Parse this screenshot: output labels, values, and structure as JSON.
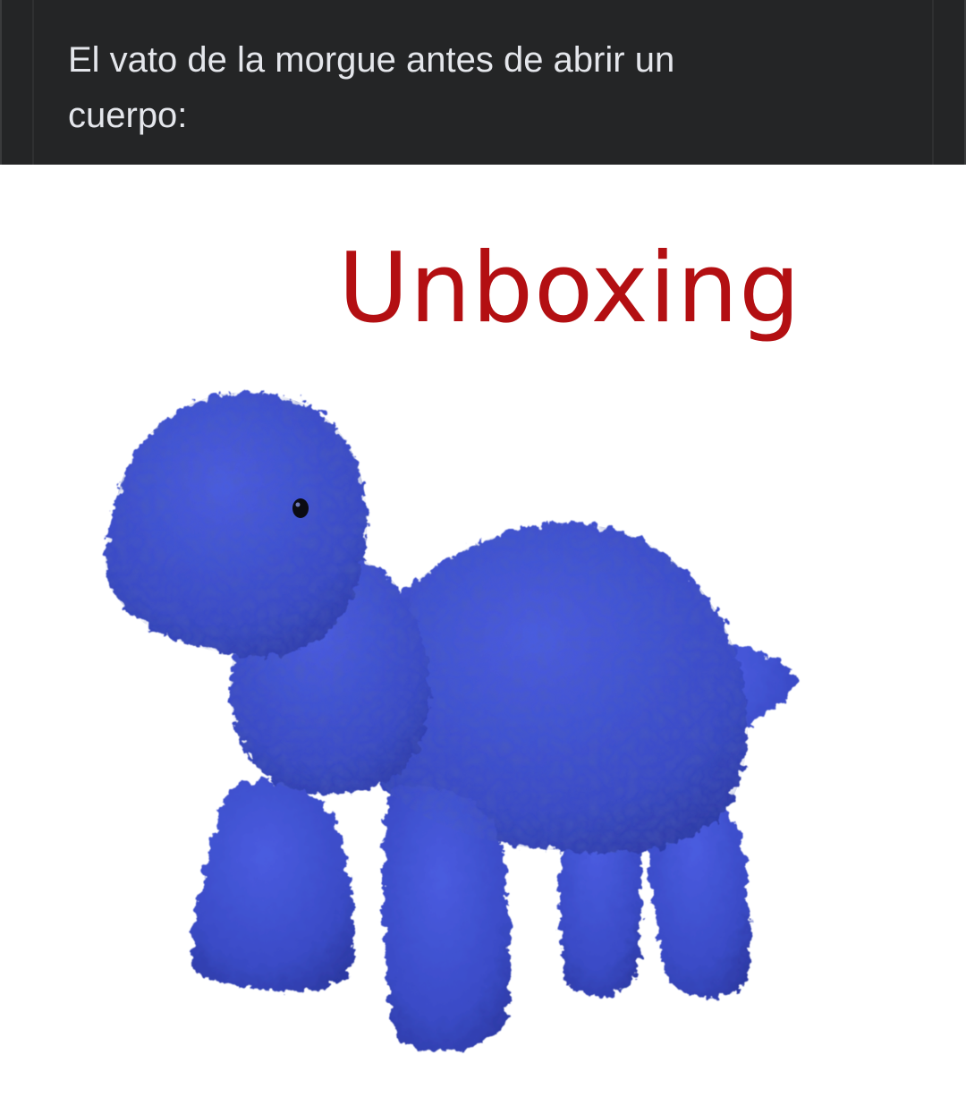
{
  "post": {
    "caption": "El vato de la morgue antes de abrir un\ncuerpo:"
  },
  "meme": {
    "title": "Unboxing",
    "title_color": "#b30f12",
    "image_subject": "blue-plush-dinosaur-image",
    "plush_color": "#3d4fc9"
  }
}
